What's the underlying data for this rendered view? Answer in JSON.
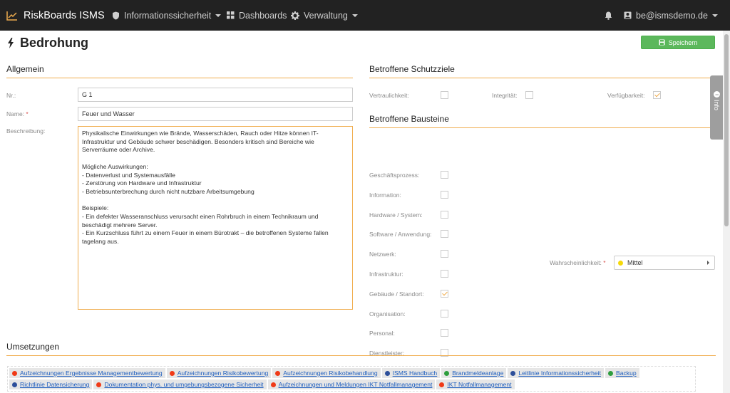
{
  "nav": {
    "brand": "RiskBoards ISMS",
    "menu": [
      {
        "label": "Informationssicherheit",
        "icon": "shield-icon",
        "dropdown": true
      },
      {
        "label": "Dashboards",
        "icon": "dashboard-grid-icon",
        "dropdown": false
      },
      {
        "label": "Verwaltung",
        "icon": "gear-icon",
        "dropdown": true
      }
    ],
    "user": "be@ismsdemo.de"
  },
  "page": {
    "title": "Bedrohung",
    "save_label": "Speichern",
    "info_label": "Info"
  },
  "allgemein": {
    "heading": "Allgemein",
    "nr_label": "Nr.:",
    "nr_value": "G 1",
    "name_label": "Name:",
    "required_mark": "*",
    "name_value": "Feuer und Wasser",
    "desc_label": "Beschreibung:",
    "desc_value": "Physikalische Einwirkungen wie Brände, Wasserschäden, Rauch oder Hitze können IT-\nInfrastruktur und Gebäude schwer beschädigen. Besonders kritisch sind Bereiche wie\nServerräume oder Archive.\n\nMögliche Auswirkungen:\n- Datenverlust und Systemausfälle\n- Zerstörung von Hardware und Infrastruktur\n- Betriebsunterbrechung durch nicht nutzbare Arbeitsumgebung\n\nBeispiele:\n- Ein defekter Wasseranschluss verursacht einen Rohrbruch in einem Technikraum und\nbeschädigt mehrere Server.\n- Ein Kurzschluss führt zu einem Feuer in einem Bürotrakt – die betroffenen Systeme fallen\ntagelang aus."
  },
  "schutzziele": {
    "heading": "Betroffene Schutzziele",
    "items": [
      {
        "label": "Vertraulichkeit:",
        "checked": false
      },
      {
        "label": "Integrität:",
        "checked": false
      },
      {
        "label": "Verfügbarkeit:",
        "checked": true
      }
    ]
  },
  "bausteine": {
    "heading": "Betroffene Bausteine",
    "items": [
      {
        "label": "Geschäftsprozess:",
        "checked": false
      },
      {
        "label": "Information:",
        "checked": false
      },
      {
        "label": "Hardware / System:",
        "checked": false
      },
      {
        "label": "Software / Anwendung:",
        "checked": false
      },
      {
        "label": "Netzwerk:",
        "checked": false
      },
      {
        "label": "Infrastruktur:",
        "checked": false
      },
      {
        "label": "Gebäude / Standort:",
        "checked": true
      },
      {
        "label": "Organisation:",
        "checked": false
      },
      {
        "label": "Personal:",
        "checked": false
      },
      {
        "label": "Dienstleister:",
        "checked": false
      }
    ]
  },
  "wahrscheinlichkeit": {
    "label": "Wahrscheinlichkeit:",
    "required_mark": "*",
    "value": "Mittel",
    "color": "#f5d90a"
  },
  "umsetzungen": {
    "heading": "Umsetzungen",
    "items": [
      {
        "label": "Aufzeichnungen Ergebnisse Managementbewertung",
        "color": "#f03a17"
      },
      {
        "label": "Aufzeichnungen Risikobewertung",
        "color": "#f03a17"
      },
      {
        "label": "Aufzeichnungen Risikobehandlung",
        "color": "#f03a17"
      },
      {
        "label": "ISMS Handbuch",
        "color": "#2d4f9a"
      },
      {
        "label": "Brandmeldeanlage",
        "color": "#2e9e3e"
      },
      {
        "label": "Leitlinie Informationssicherheit",
        "color": "#2d4f9a"
      },
      {
        "label": "Backup",
        "color": "#2e9e3e"
      },
      {
        "label": "Richtlinie Datensicherung",
        "color": "#2d4f9a"
      },
      {
        "label": "Dokumentation phys. und umgebungsbezogene Sicherheit",
        "color": "#f03a17"
      },
      {
        "label": "Aufzeichnungen und Meldungen IKT Notfallmanagement",
        "color": "#f03a17"
      },
      {
        "label": "IKT Notfallmanagement",
        "color": "#f03a17"
      }
    ]
  },
  "colors": {
    "navbar": "#222222",
    "accent": "#f0ad4e",
    "save_button": "#5cb85c",
    "link": "#1f5fbf"
  }
}
